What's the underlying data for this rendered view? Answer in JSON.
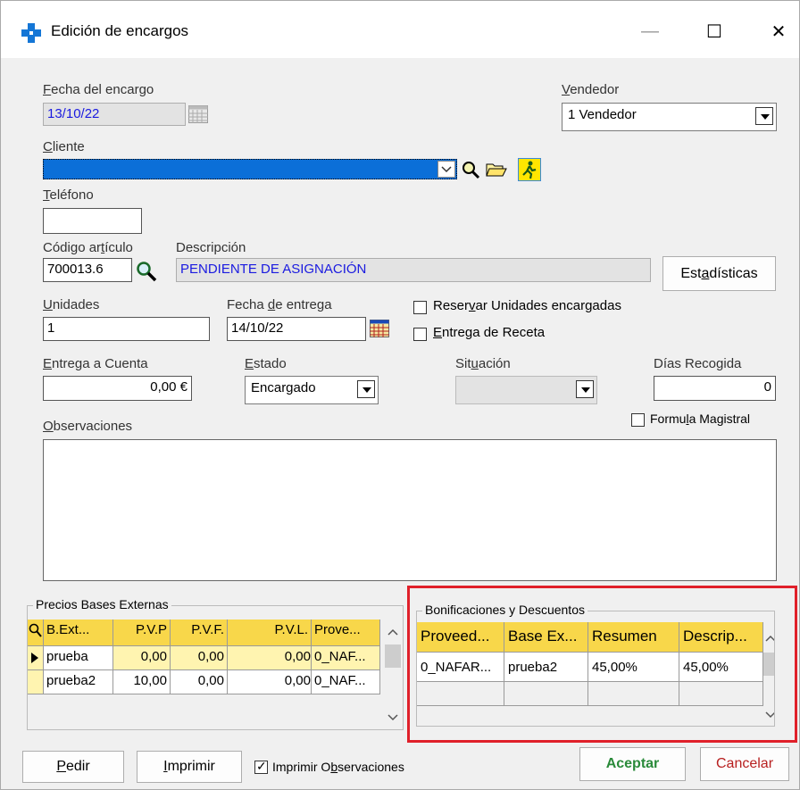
{
  "window": {
    "title": "Edición de encargos",
    "minimize": "—",
    "maximize": "☐",
    "close": "✕"
  },
  "form": {
    "fecha_encargo": {
      "label_pre": "F",
      "label_rest": "echa del encargo",
      "value": "13/10/22"
    },
    "vendedor": {
      "label_pre": "V",
      "label_rest": "endedor",
      "value": "1 Vendedor"
    },
    "cliente": {
      "label_pre": "C",
      "label_rest": "liente",
      "value": ""
    },
    "telefono": {
      "label_pre": "T",
      "label_rest": "eléfono",
      "value": ""
    },
    "codigo": {
      "label_a": "Código ar",
      "label_u": "t",
      "label_b": "ículo",
      "value": "700013.6"
    },
    "descripcion": {
      "label": "Descripción",
      "value": "PENDIENTE DE ASIGNACIÓN"
    },
    "estadisticas": {
      "label_a": "Est",
      "label_u": "a",
      "label_b": "dísticas"
    },
    "unidades": {
      "label_pre": "U",
      "label_rest": "nidades",
      "value": "1"
    },
    "fecha_entrega": {
      "label_a": "Fecha ",
      "label_u": "d",
      "label_b": "e entrega",
      "value": "14/10/22"
    },
    "reservar": {
      "label_a": "Reser",
      "label_u": "v",
      "label_b": "ar Unidades encargadas",
      "checked": false
    },
    "receta": {
      "label_pre": "E",
      "label_rest": "ntrega de Receta",
      "checked": false
    },
    "entrega_cuenta": {
      "label_pre": "E",
      "label_rest": "ntrega a Cuenta",
      "value": "0,00 €"
    },
    "estado": {
      "label_pre": "E",
      "label_rest": "stado",
      "value": "Encargado"
    },
    "situacion": {
      "label_a": "Sit",
      "label_u": "u",
      "label_b": "ación",
      "value": ""
    },
    "dias": {
      "label": "Días Recogida",
      "value": "0"
    },
    "formula": {
      "label_a": "Formu",
      "label_u": "l",
      "label_b": "a Magistral",
      "checked": false
    },
    "observaciones": {
      "label_pre": "O",
      "label_rest": "bservaciones",
      "value": ""
    }
  },
  "precios": {
    "title": "Precios Bases Externas",
    "headers": [
      "B.Ext...",
      "P.V.P",
      "P.V.F.",
      "P.V.L.",
      "Prove..."
    ],
    "rows": [
      [
        "prueba",
        "0,00",
        "0,00",
        "0,00",
        "0_NAF..."
      ],
      [
        "prueba2",
        "10,00",
        "0,00",
        "0,00",
        "0_NAF..."
      ]
    ]
  },
  "bonificaciones": {
    "title": "Bonificaciones y Descuentos",
    "headers": [
      "Proveed...",
      "Base Ex...",
      "Resumen",
      "Descrip..."
    ],
    "rows": [
      [
        "0_NAFAR...",
        "prueba2",
        "45,00%",
        "45,00%"
      ]
    ]
  },
  "footer": {
    "pedir": {
      "pre": "P",
      "rest": "edir"
    },
    "imprimir": {
      "pre": "I",
      "rest": "mprimir"
    },
    "imprimir_obs": {
      "label_a": "Imprimir O",
      "label_u": "b",
      "label_b": "servaciones",
      "checked": true
    },
    "aceptar": "Aceptar",
    "cancelar": "Cancelar"
  },
  "colors": {
    "highlight_box": "#e0202a",
    "client_field": "#0b6fd8",
    "grid_header": "#f8d74a",
    "grid_row": "#fff4b0",
    "accept_text": "#2a8a3a",
    "cancel_text": "#b82020",
    "description_text": "#1a1ae0"
  }
}
